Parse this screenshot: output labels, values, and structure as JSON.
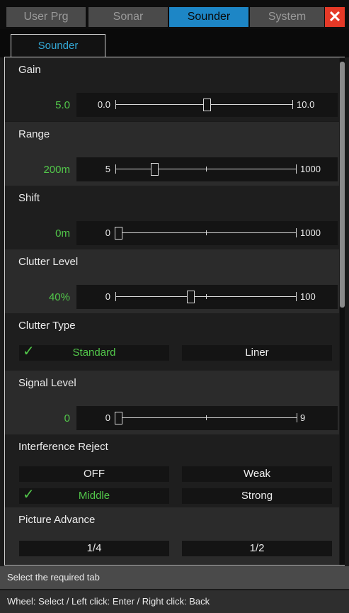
{
  "tabs": [
    "User Prg",
    "Sonar",
    "Sounder",
    "System"
  ],
  "active_tab": "Sounder",
  "close_label": "✕",
  "subtab": "Sounder",
  "settings": {
    "gain": {
      "label": "Gain",
      "value": "5.0",
      "min": "0.0",
      "max": "10.0",
      "level": 0.5
    },
    "range": {
      "label": "Range",
      "value": "200m",
      "min": "5",
      "max": "1000",
      "level": 0.2
    },
    "shift": {
      "label": "Shift",
      "value": "0m",
      "min": "0",
      "max": "1000",
      "level": 0.0
    },
    "clutter_level": {
      "label": "Clutter Level",
      "value": "40%",
      "min": "0",
      "max": "100",
      "level": 0.4
    },
    "clutter_type": {
      "label": "Clutter Type",
      "options": [
        "Standard",
        "Liner"
      ],
      "selected": "Standard"
    },
    "signal_level": {
      "label": "Signal Level",
      "value": "0",
      "min": "0",
      "max": "9",
      "level": 0.0
    },
    "interference_reject": {
      "label": "Interference Reject",
      "options": [
        "OFF",
        "Weak",
        "Middle",
        "Strong"
      ],
      "selected": "Middle"
    },
    "picture_advance": {
      "label": "Picture Advance",
      "options": [
        "1/4",
        "1/2"
      ]
    }
  },
  "check_mark": "✓",
  "status_hint": "Select the required tab",
  "controls_hint": "Wheel: Select / Left click: Enter / Right click: Back",
  "colors": {
    "accent_tab": "#1d86c6",
    "selected_text": "#52c74a",
    "close_button": "#e53927"
  }
}
